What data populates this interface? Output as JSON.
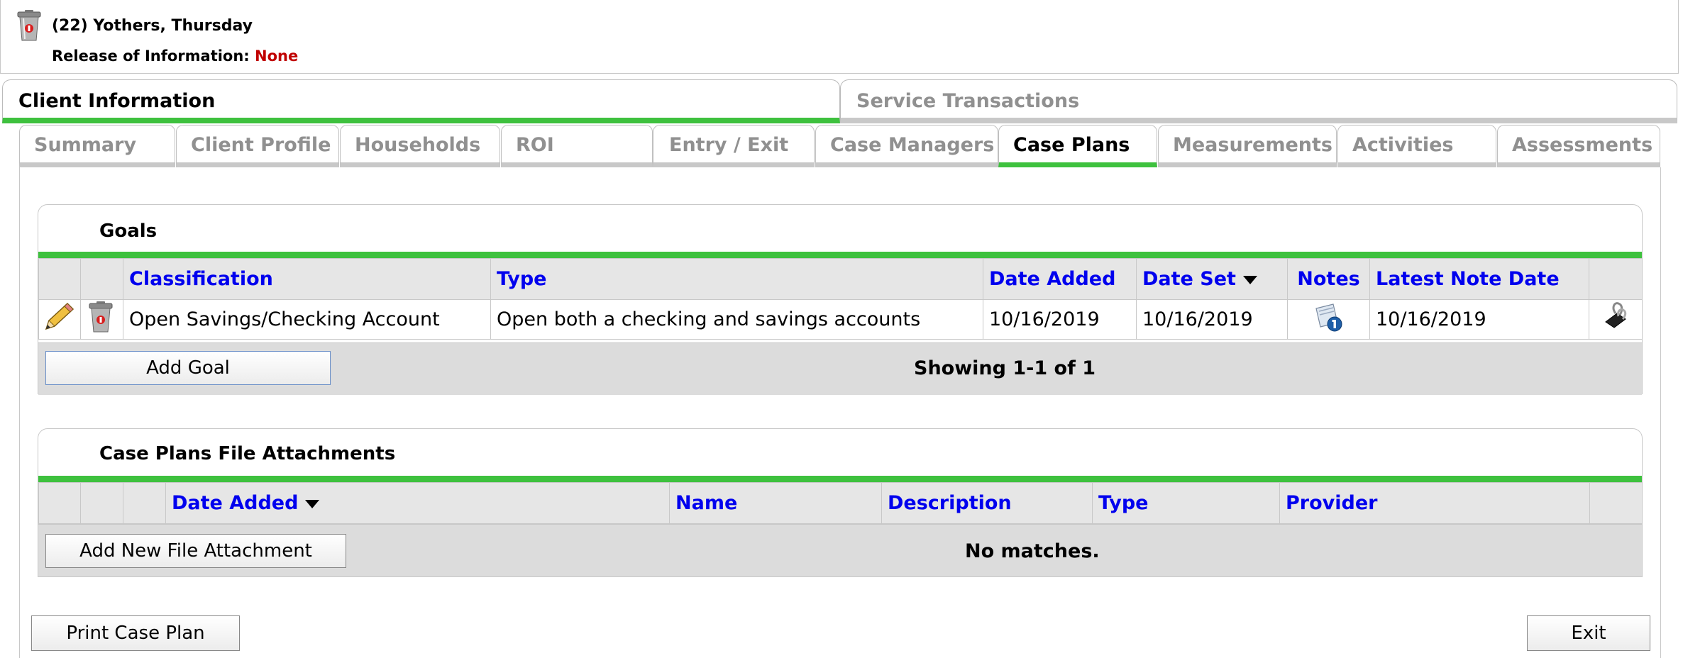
{
  "client": {
    "name": "(22) Yothers, Thursday",
    "roi_label": "Release of Information:",
    "roi_value": "None"
  },
  "main_tabs": [
    {
      "label": "Client Information",
      "active": true
    },
    {
      "label": "Service Transactions",
      "active": false
    }
  ],
  "sub_tabs": [
    {
      "label": "Summary"
    },
    {
      "label": "Client Profile"
    },
    {
      "label": "Households"
    },
    {
      "label": "ROI"
    },
    {
      "label": "Entry / Exit"
    },
    {
      "label": "Case Managers"
    },
    {
      "label": "Case Plans"
    },
    {
      "label": "Measurements"
    },
    {
      "label": "Activities"
    },
    {
      "label": "Assessments"
    }
  ],
  "goals": {
    "title": "Goals",
    "columns": [
      "Classification",
      "Type",
      "Date Added",
      "Date Set",
      "Notes",
      "Latest Note Date"
    ],
    "rows": [
      {
        "classification": "Open Savings/Checking Account",
        "type": "Open both a checking and savings accounts",
        "date_added": "10/16/2019",
        "date_set": "10/16/2019",
        "latest_note_date": "10/16/2019"
      }
    ],
    "add_button": "Add Goal",
    "showing": "Showing 1-1 of 1"
  },
  "attachments": {
    "title": "Case Plans File Attachments",
    "columns": [
      "Date Added",
      "Name",
      "Description",
      "Type",
      "Provider"
    ],
    "add_button": "Add New File Attachment",
    "no_matches": "No matches."
  },
  "actions": {
    "print": "Print Case Plan",
    "exit": "Exit"
  },
  "colors": {
    "accent_green": "#3ec13e",
    "link_blue": "#0000ee",
    "roi_red": "#c00000"
  }
}
